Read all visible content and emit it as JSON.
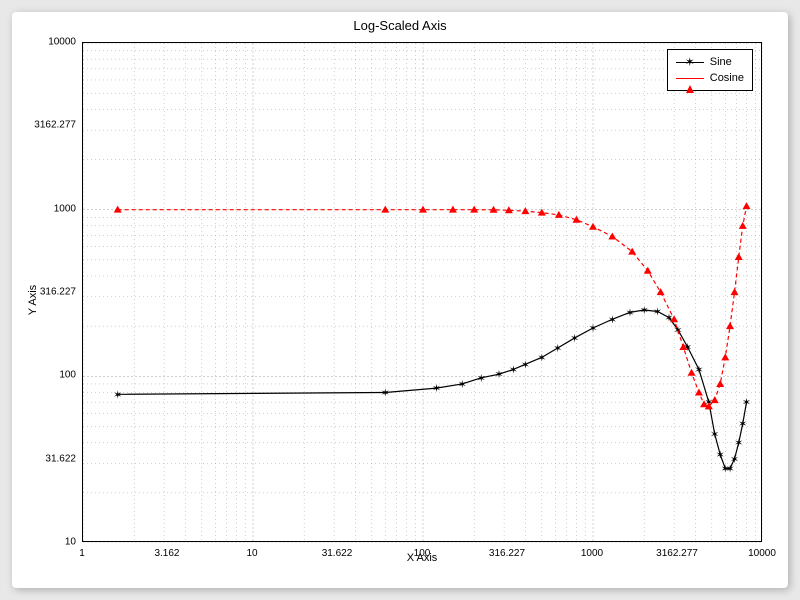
{
  "title": "Log-Scaled Axis",
  "xlabel": "X Axis",
  "ylabel": "Y Axis",
  "xticks": [
    1,
    3.162,
    10,
    31.622,
    100,
    316.227,
    1000,
    3162.277,
    10000
  ],
  "yticks": [
    10,
    31.622,
    100,
    316.227,
    1000,
    3162.277,
    10000
  ],
  "xtick_labels": [
    "1",
    "3.162",
    "10",
    "31.622",
    "100",
    "316.227",
    "1000",
    "3162.277",
    "10000"
  ],
  "ytick_labels": [
    "10",
    "31.622",
    "100",
    "316.227",
    "1000",
    "3162.277",
    "10000"
  ],
  "legend": {
    "position": "top-right",
    "items": [
      "Sine",
      "Cosine"
    ]
  },
  "series_style": {
    "Sine": {
      "color": "#000000",
      "marker": "star6",
      "line": "solid"
    },
    "Cosine": {
      "color": "#ff0000",
      "marker": "triangle",
      "line": "dash"
    }
  },
  "chart_data": {
    "type": "line",
    "xscale": "log",
    "yscale": "log",
    "xlim": [
      1,
      10000
    ],
    "ylim": [
      10,
      10000
    ],
    "title": "Log-Scaled Axis",
    "xlabel": "X Axis",
    "ylabel": "Y Axis",
    "legend": [
      "Sine",
      "Cosine"
    ],
    "series": [
      {
        "name": "Sine",
        "x": [
          1.6,
          60,
          120,
          170,
          220,
          280,
          340,
          400,
          500,
          620,
          780,
          1000,
          1300,
          1650,
          2000,
          2400,
          2800,
          3162,
          3600,
          4200,
          4800,
          5200,
          5600,
          6000,
          6400,
          6800,
          7200,
          7600,
          8000
        ],
        "y": [
          78,
          80,
          85,
          90,
          98,
          103,
          110,
          118,
          130,
          148,
          170,
          195,
          220,
          242,
          250,
          245,
          225,
          190,
          150,
          110,
          70,
          45,
          34,
          28,
          28,
          32,
          40,
          52,
          70
        ]
      },
      {
        "name": "Cosine",
        "x": [
          1.6,
          60,
          100,
          150,
          200,
          260,
          320,
          400,
          500,
          630,
          800,
          1000,
          1300,
          1700,
          2100,
          2500,
          3000,
          3400,
          3800,
          4200,
          4500,
          4800,
          5200,
          5600,
          6000,
          6400,
          6800,
          7200,
          7600,
          8000
        ],
        "y": [
          1000,
          1000,
          1000,
          1000,
          1000,
          998,
          992,
          980,
          960,
          930,
          870,
          790,
          690,
          560,
          430,
          320,
          220,
          150,
          105,
          80,
          68,
          66,
          72,
          90,
          130,
          200,
          320,
          520,
          800,
          1050
        ]
      }
    ]
  }
}
